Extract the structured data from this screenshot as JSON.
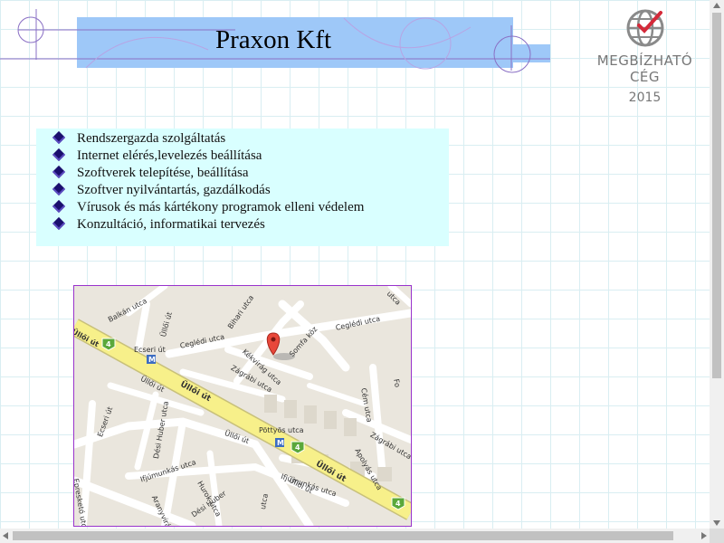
{
  "header": {
    "title": "Praxon Kft"
  },
  "badge": {
    "line1": "MEGBÍZHATÓ",
    "line2": "CÉG",
    "year": "2015",
    "icon": "globe-check-icon"
  },
  "services": {
    "items": [
      "Rendszergazda szolgáltatás",
      "Internet elérés,levelezés beállítása",
      "Szoftverek telepítése, beállítása",
      "Szoftver nyilvántartás, gazdálkodás",
      "Vírusok és más kártékony programok elleni védelem",
      "Konzultáció, informatikai tervezés"
    ],
    "bullet_color": "#1a0f6e",
    "background": "#d9ffff"
  },
  "map": {
    "labels": {
      "balkan": "Balkán utca",
      "ulloi_main": "Üllői út",
      "ulloi_small1": "Üllői út",
      "ulloi_small2": "Üllői út",
      "ulloi_small3": "Üllői út",
      "ulloi_small4": "Üllői út",
      "ecseri_ut": "Ecseri út",
      "ecseri_ut2": "Ecseri út",
      "cegledi1": "Ceglédi utca",
      "cegledi2": "Ceglédi utca",
      "bihari": "Bihari utca",
      "kekviragu": "Kékvirág utca",
      "somfa": "Somfa köz",
      "zagrabi1": "Zágrábi utca",
      "zagrabi2": "Zágrábi utca",
      "pottyos": "Pöttyös utca",
      "desi1": "Dési Huber utca",
      "desi2": "Dési Huber",
      "ifjumunkas1": "Ifjúmunkás utca",
      "ifjumunkas2": "Ifjúmunkás utca",
      "hurok": "Hurok utca",
      "aranyvirag": "Aranyvirág",
      "epresketo": "Epresketó utca",
      "cem": "Cém utca",
      "apolyas": "Apolyás utca",
      "fo": "Fo",
      "lahu": "utca",
      "route4": "4",
      "metro": "M"
    },
    "pin_color": "#e8473a",
    "road_main_color": "#f7f08a"
  }
}
